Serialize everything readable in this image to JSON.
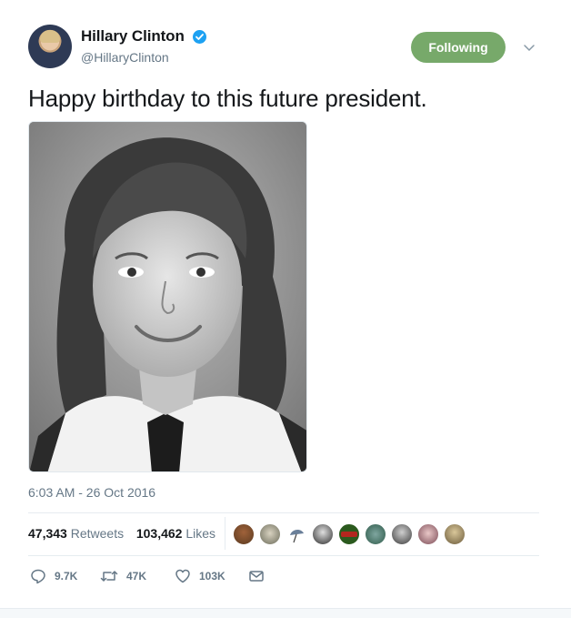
{
  "author": {
    "name": "Hillary Clinton",
    "handle": "@HillaryClinton",
    "verified": true
  },
  "follow_button": {
    "label": "Following",
    "color": "#77a96a"
  },
  "tweet": {
    "text": "Happy birthday to this future president.",
    "timestamp": "6:03 AM - 26 Oct 2016"
  },
  "stats": {
    "retweets_count": "47,343",
    "retweets_label": "Retweets",
    "likes_count": "103,462",
    "likes_label": "Likes"
  },
  "actions": {
    "replies": "9.7K",
    "retweets": "47K",
    "likes": "103K"
  },
  "icons": [
    "verified-badge-icon",
    "caret-down-icon",
    "reply-icon",
    "retweet-icon",
    "heart-icon",
    "message-icon"
  ],
  "colors": {
    "accent": "#1da1f2",
    "muted": "#657786",
    "following": "#77a96a"
  }
}
